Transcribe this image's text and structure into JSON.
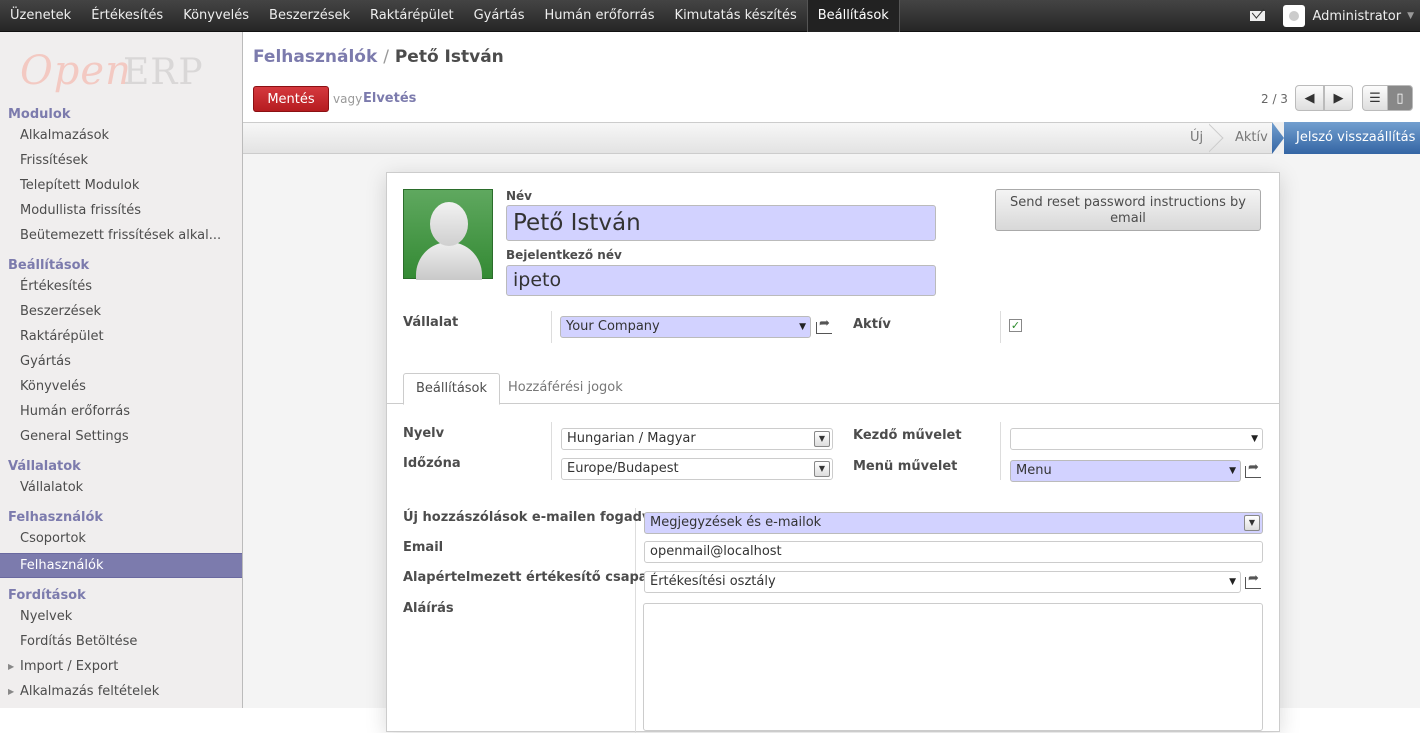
{
  "topmenu": [
    "Üzenetek",
    "Értékesítés",
    "Könyvelés",
    "Beszerzések",
    "Raktárépület",
    "Gyártás",
    "Humán erőforrás",
    "Kimutatás készítés",
    "Beállítások"
  ],
  "user": {
    "name": "Administrator"
  },
  "logo": {
    "part1": "Open",
    "part2": "ERP"
  },
  "sidebar": {
    "sections": [
      {
        "title": "Modulok",
        "items": [
          "Alkalmazások",
          "Frissítések",
          "Telepített Modulok",
          "Modullista frissítés",
          "Beütemezett frissítések alkal..."
        ]
      },
      {
        "title": "Beállítások",
        "items": [
          "Értékesítés",
          "Beszerzések",
          "Raktárépület",
          "Gyártás",
          "Könyvelés",
          "Humán erőforrás",
          "General Settings"
        ]
      },
      {
        "title": "Vállalatok",
        "items": [
          "Vállalatok"
        ]
      },
      {
        "title": "Felhasználók",
        "items": [
          "Csoportok",
          "Felhasználók"
        ]
      },
      {
        "title": "Fordítások",
        "items": [
          "Nyelvek",
          "Fordítás Betöltése",
          "Import / Export",
          "Alkalmazás feltételek"
        ]
      }
    ]
  },
  "header": {
    "breadcrumb_parent": "Felhasználók",
    "breadcrumb_sep": "/",
    "breadcrumb_current": "Pető István",
    "save_label": "Mentés",
    "or_label": "vagy",
    "discard_label": "Elvetés",
    "pager": "2 / 3"
  },
  "status": {
    "steps": [
      "Új",
      "Aktív",
      "Jelszó visszaállítás"
    ],
    "active": "Jelszó visszaállítás"
  },
  "form": {
    "name_label": "Név",
    "name_value": "Pető István",
    "login_label": "Bejelentkező név",
    "login_value": "ipeto",
    "reset_button": "Send reset password instructions by email",
    "company_label": "Vállalat",
    "company_value": "Your Company",
    "active_label": "Aktív",
    "active_checked": true,
    "tabs": [
      "Beállítások",
      "Hozzáférési jogok"
    ],
    "language_label": "Nyelv",
    "language_value": "Hungarian / Magyar",
    "timezone_label": "Időzóna",
    "timezone_value": "Europe/Budapest",
    "home_action_label": "Kezdő művelet",
    "home_action_value": "",
    "menu_action_label": "Menü művelet",
    "menu_action_value": "Menu",
    "notify_label": "Új hozzászólások e-mailen fogadva",
    "notify_value": "Megjegyzések és e-mailok",
    "email_label": "Email",
    "email_value": "openmail@localhost",
    "sales_team_label": "Alapértelmezett értékesítő csapat",
    "sales_team_value": "Értékesítési osztály",
    "signature_label": "Aláírás"
  },
  "colors": {
    "accent": "#7c7bad",
    "save": "#c52a2f",
    "status_active": "#4a7fc1",
    "required_field": "#d2d2ff"
  }
}
